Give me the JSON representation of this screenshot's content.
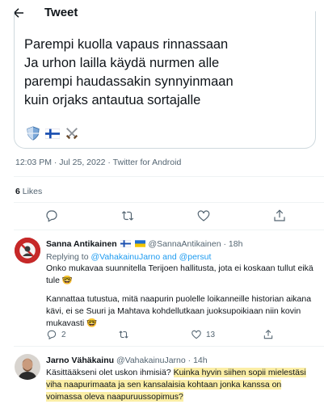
{
  "header": {
    "title": "Tweet"
  },
  "quoted": {
    "lines": [
      "Parempi kuolla vapaus rinnassaan",
      "Ja urhon lailla käydä nurmen alle",
      "parempi haudassakin synnyinmaan",
      "kuin orjaks antautua sortajalle"
    ],
    "emojis": [
      "shield-icon",
      "finland-flag-icon",
      "crossed-swords-icon"
    ]
  },
  "tweet_meta": {
    "time": "12:03 PM",
    "sep1": " · ",
    "date": "Jul 25, 2022",
    "sep2": " · ",
    "source": "Twitter for Android"
  },
  "likes": {
    "count": "6",
    "label": " Likes"
  },
  "replies": [
    {
      "name": "Sanna Antikainen",
      "handle": "@SannaAntikainen",
      "time": "18h",
      "replying_prefix": "Replying to ",
      "replying_users": "@VahakainuJarno",
      "replying_and": " and ",
      "replying_user2": "@persut",
      "para1": "Onko mukavaa suunnitella Terijoen hallitusta, jota ei koskaan tullut eikä tule 🤓",
      "para2": "Kannattaa tutustua, mitä naapurin puolelle loikanneille historian aikana kävi, ei se Suuri ja Mahtava kohdellutkaan juoksupoikiaan niin kovin mukavasti 🤓",
      "reply_count": "2",
      "retweet_count": "",
      "like_count": "13"
    },
    {
      "name": "Jarno Vähäkainu",
      "handle": "@VahakainuJarno",
      "time": "14h",
      "text_plain": "Käsittääkseni olet uskon ihmisiä? ",
      "text_highlight": "Kuinka hyvin siihen sopii mielestäsi viha naapurimaata ja sen kansalaisia kohtaan jonka kanssa on voimassa oleva naapuruussopimus?"
    }
  ],
  "colors": {
    "link": "#1d9bf0",
    "muted": "#536471",
    "highlight": "#fbeea6",
    "border": "#cfd9de"
  }
}
